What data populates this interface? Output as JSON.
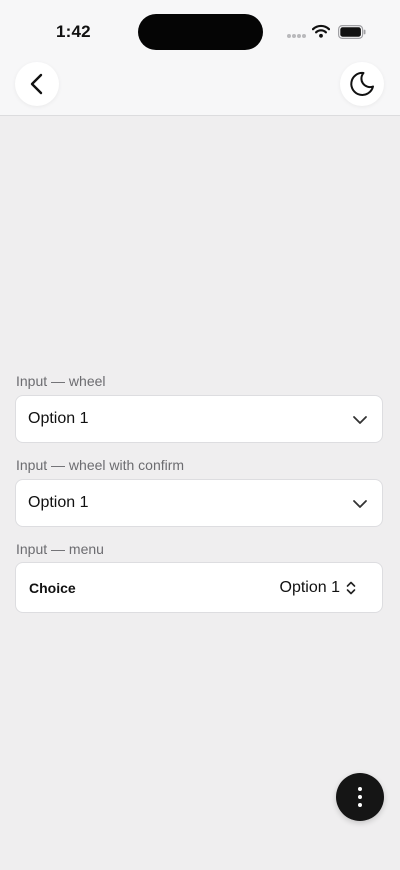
{
  "status_bar": {
    "time": "1:42"
  },
  "nav": {
    "back_icon": "chevron-left-icon",
    "theme_icon": "moon-icon"
  },
  "fields": {
    "wheel": {
      "label": "Input — wheel",
      "value": "Option 1"
    },
    "wheel_confirm": {
      "label": "Input — wheel with confirm",
      "value": "Option 1"
    },
    "menu": {
      "label": "Input — menu",
      "row_label": "Choice",
      "value": "Option 1"
    }
  },
  "fab": {
    "icon": "more-vertical-icon"
  },
  "colors": {
    "background": "#efeeef",
    "surface": "#ffffff",
    "text": "#111111",
    "label": "#6c6c70",
    "fab": "#151515"
  }
}
